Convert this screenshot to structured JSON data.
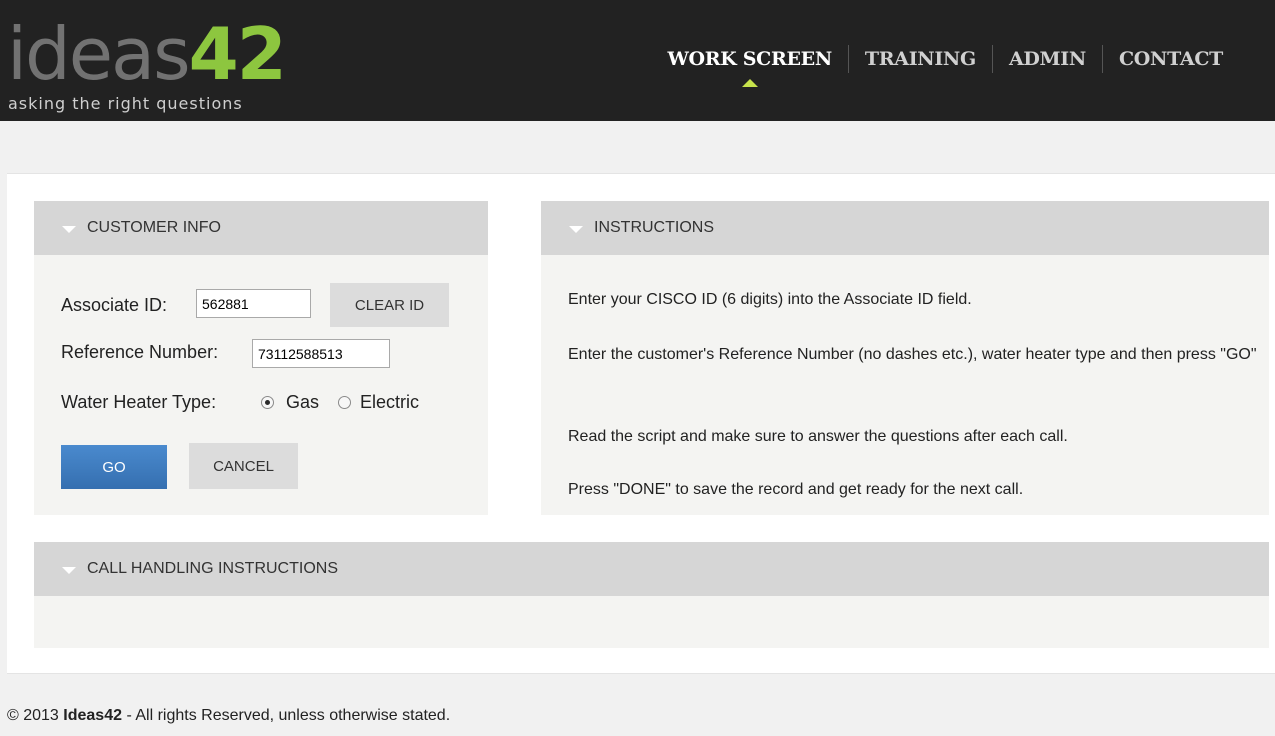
{
  "logo": {
    "word": "ideas",
    "number": "42",
    "tagline": "asking the right questions"
  },
  "nav": {
    "items": [
      {
        "label": "WORK SCREEN",
        "active": true
      },
      {
        "label": "TRAINING",
        "active": false
      },
      {
        "label": "ADMIN",
        "active": false
      },
      {
        "label": "CONTACT",
        "active": false
      }
    ]
  },
  "customer_info": {
    "title": "CUSTOMER INFO",
    "associate_id_label": "Associate ID:",
    "associate_id_value": "562881",
    "clear_id_label": "CLEAR ID",
    "reference_label": "Reference Number:",
    "reference_value": "73112588513",
    "heater_label": "Water Heater Type:",
    "heater_options": [
      {
        "label": "Gas",
        "selected": true
      },
      {
        "label": "Electric",
        "selected": false
      }
    ],
    "go_label": "GO",
    "cancel_label": "CANCEL"
  },
  "instructions": {
    "title": "INSTRUCTIONS",
    "lines": [
      "Enter your CISCO ID (6 digits) into the Associate ID field.",
      "Enter the customer's Reference Number (no dashes etc.), water heater type and then press \"GO\"",
      "Read the script and make sure to answer the questions after each call.",
      "Press \"DONE\" to save the record and get ready for the next call."
    ]
  },
  "call_handling": {
    "title": "CALL HANDLING INSTRUCTIONS"
  },
  "footer": {
    "prefix": "© 2013 ",
    "brand": "Ideas42",
    "suffix": " - All rights Reserved, unless otherwise stated."
  },
  "colors": {
    "header_bg": "#222222",
    "logo_green": "#8dc63f",
    "nav_caret": "#c6e24b",
    "primary_button": "#3f7fc0"
  }
}
